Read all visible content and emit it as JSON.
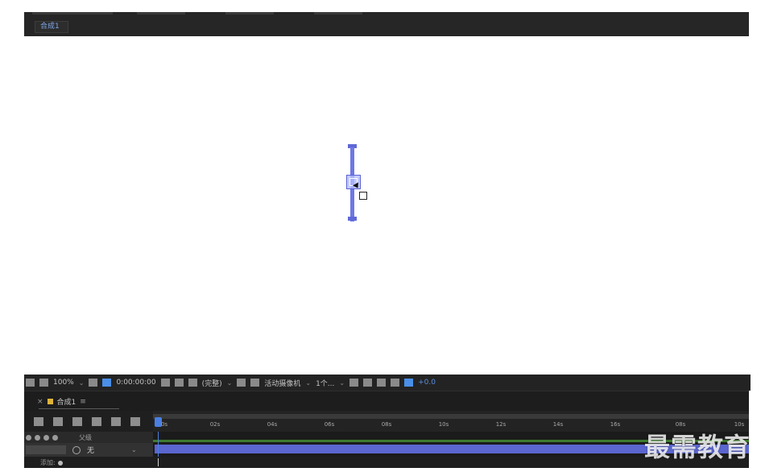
{
  "composition_tab": {
    "label": "合成1"
  },
  "viewer_toolbar": {
    "zoom": "100%",
    "timecode": "0:00:00:00",
    "resolution": "(完整)",
    "camera": "活动摄像机",
    "views": "1个...",
    "exposure": "+0.0"
  },
  "timeline": {
    "tab_label": "合成1",
    "ruler_ticks": [
      "0s",
      "02s",
      "04s",
      "06s",
      "08s",
      "10s",
      "12s",
      "14s",
      "16s",
      "08s",
      "10s"
    ],
    "layer_header": {
      "parent_label": "父级"
    },
    "layer": {
      "parent_value": "无"
    },
    "add_label": "添加:"
  },
  "watermark": "最需教育",
  "colors": {
    "shape": "#6f78e3",
    "layer_bar": "#5b66cf",
    "playhead": "#4a7fe0",
    "panel_dark": "#232323"
  }
}
